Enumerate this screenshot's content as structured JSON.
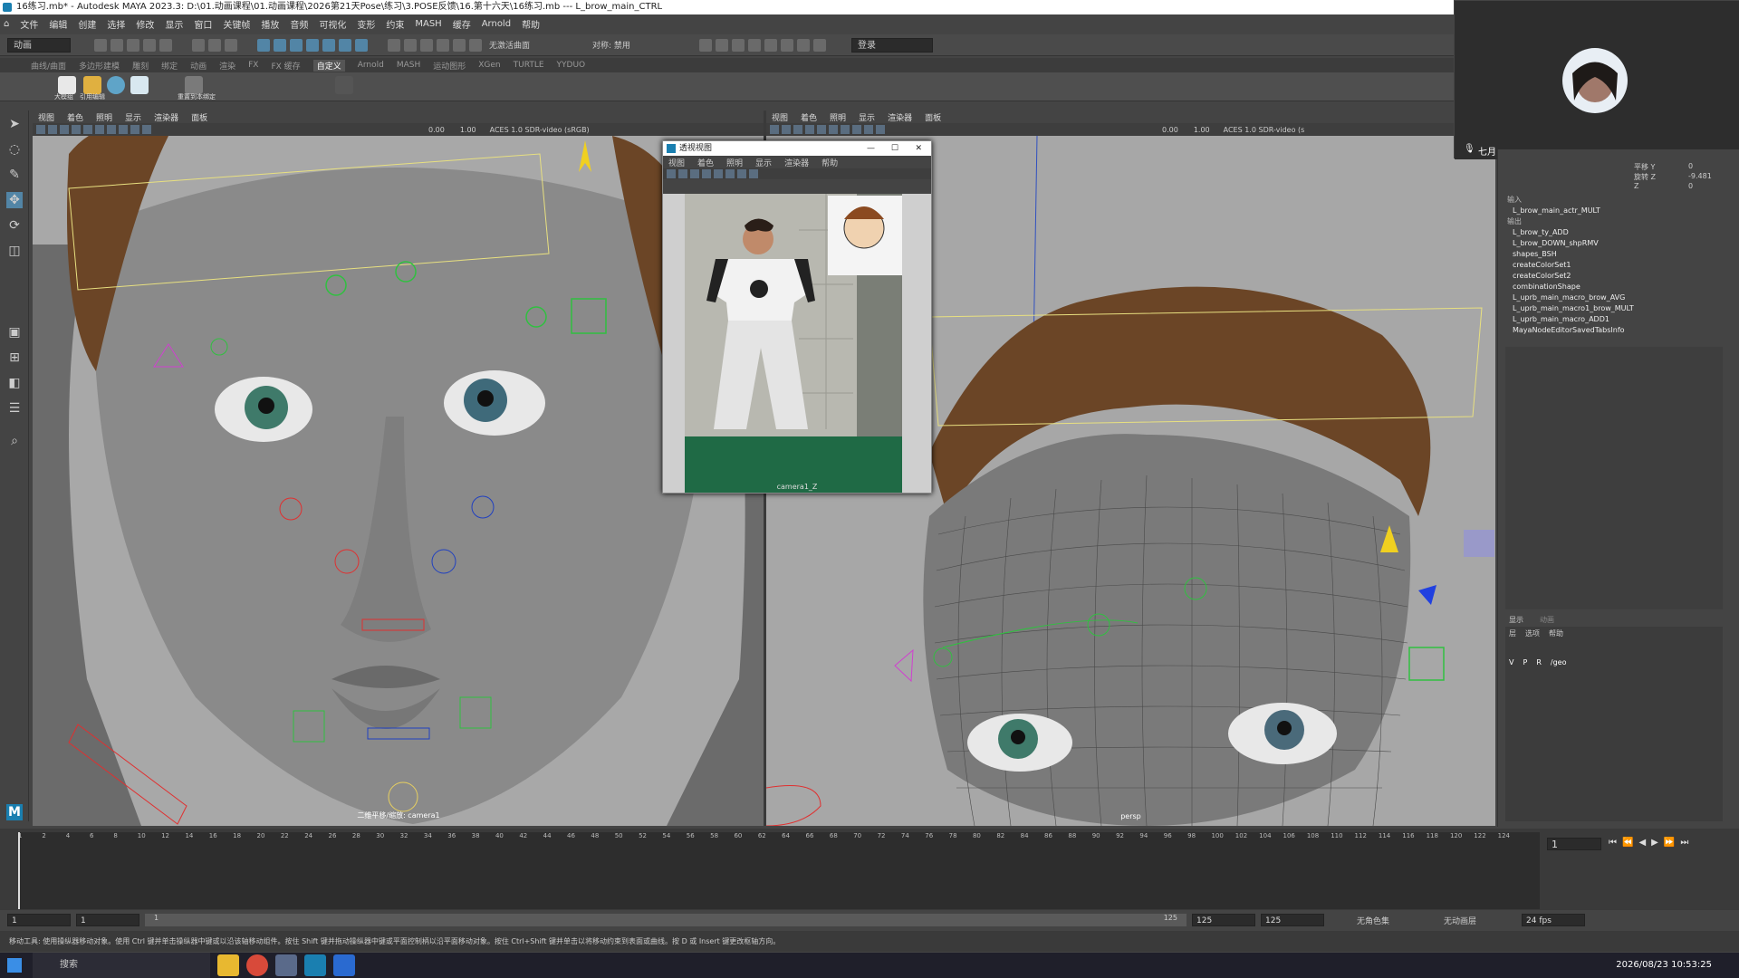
{
  "window": {
    "title": "16练习.mb* - Autodesk MAYA 2023.3: D:\\01.动画课程\\01.动画课程\\2026第21天Pose\\练习\\3.POSE反馈\\16.第十六天\\16练习.mb  ---  L_brow_main_CTRL"
  },
  "menubar": {
    "items": [
      "文件",
      "编辑",
      "创建",
      "选择",
      "修改",
      "显示",
      "窗口",
      "关键帧",
      "播放",
      "音频",
      "可视化",
      "变形",
      "约束",
      "MASH",
      "缓存",
      "Arnold",
      "帮助"
    ]
  },
  "statusline": {
    "mode": "动画",
    "constrain": "无激活曲面",
    "symmetry": "对称: 禁用",
    "login": "登录"
  },
  "shelf": {
    "tabs": [
      "曲线/曲面",
      "多边形建模",
      "雕刻",
      "绑定",
      "动画",
      "渲染",
      "FX",
      "FX 缓存",
      "自定义",
      "Arnold",
      "MASH",
      "运动图形",
      "XGen",
      "TURTLE",
      "YYDUO"
    ],
    "active": "自定义",
    "items": [
      "大模组",
      "引用编辑",
      "",
      "",
      "",
      "",
      "重置到本绑定"
    ]
  },
  "viewport_left": {
    "menu": [
      "视图",
      "着色",
      "照明",
      "显示",
      "渲染器",
      "面板"
    ],
    "value1": "0.00",
    "value2": "1.00",
    "colorspace": "ACES 1.0 SDR-video (sRGB)",
    "camera": "二维平移/缩放: camera1"
  },
  "viewport_right": {
    "menu": [
      "视图",
      "着色",
      "照明",
      "显示",
      "渲染器",
      "面板"
    ],
    "value1": "0.00",
    "value2": "1.00",
    "colorspace": "ACES 1.0 SDR-video (s",
    "camera": "persp"
  },
  "floating_panel": {
    "title": "透视视图",
    "menu": [
      "视图",
      "着色",
      "照明",
      "显示",
      "渲染器",
      "帮助"
    ],
    "camera": "camera1_Z"
  },
  "channel_box": {
    "rows": [
      {
        "label": "平移 Y",
        "value": "0"
      },
      {
        "label": "旋转 Z",
        "value": "-9.481"
      },
      {
        "label": "Z",
        "value": "0"
      }
    ],
    "inputs_header": "输入",
    "outputs_header": "输出",
    "nodes": [
      "L_brow_main_actr_MULT",
      "L_brow_ty_ADD",
      "L_brow_DOWN_shpRMV",
      "shapes_BSH",
      "createColorSet1",
      "createColorSet2",
      "combinationShape",
      "L_uprb_main_macro_brow_AVG",
      "L_uprb_main_macro1_brow_MULT",
      "L_uprb_main_macro_ADD1",
      "MayaNodeEditorSavedTabsInfo"
    ]
  },
  "layer_editor": {
    "tabs": [
      "显示",
      "动画"
    ],
    "menu": [
      "层",
      "选项",
      "帮助"
    ],
    "layer_flags": [
      "V",
      "P",
      "R"
    ],
    "layer_name": "/geo"
  },
  "webcam": {
    "user": "七月"
  },
  "timeslider": {
    "ticks": [
      "1",
      "2",
      "4",
      "6",
      "8",
      "10",
      "12",
      "14",
      "16",
      "18",
      "20",
      "22",
      "24",
      "26",
      "28",
      "30",
      "32",
      "34",
      "36",
      "38",
      "40",
      "42",
      "44",
      "46",
      "48",
      "50",
      "52",
      "54",
      "56",
      "58",
      "60",
      "62",
      "64",
      "66",
      "68",
      "70",
      "72",
      "74",
      "76",
      "78",
      "80",
      "82",
      "84",
      "86",
      "88",
      "90",
      "92",
      "94",
      "96",
      "98",
      "100",
      "102",
      "104",
      "106",
      "108",
      "110",
      "112",
      "114",
      "116",
      "118",
      "120",
      "122",
      "124"
    ],
    "current_frame": "1"
  },
  "rangebar": {
    "start": "1",
    "start2": "1",
    "range_mid": "1",
    "end_a": "125",
    "end_b": "125",
    "end_c": "125",
    "character": "无角色集",
    "anim_layer": "无动画层",
    "fps": "24 fps"
  },
  "helpline": {
    "text": "移动工具: 使用操纵器移动对象。使用 Ctrl 键并单击操纵器中键或以沿该轴移动组件。按住 Shift 键并拖动操纵器中键或平面控制柄以沿平面移动对象。按住 Ctrl+Shift 键并单击以将移动约束到表面或曲线。按 D 或 Insert 键更改枢轴方向。"
  },
  "taskbar": {
    "search": "搜索",
    "clock": "2026/08/23 10:53:25"
  },
  "colors": {
    "maya_bg": "#444444",
    "viewport_bg": "#a8a8a8",
    "accent": "#5285a6"
  }
}
